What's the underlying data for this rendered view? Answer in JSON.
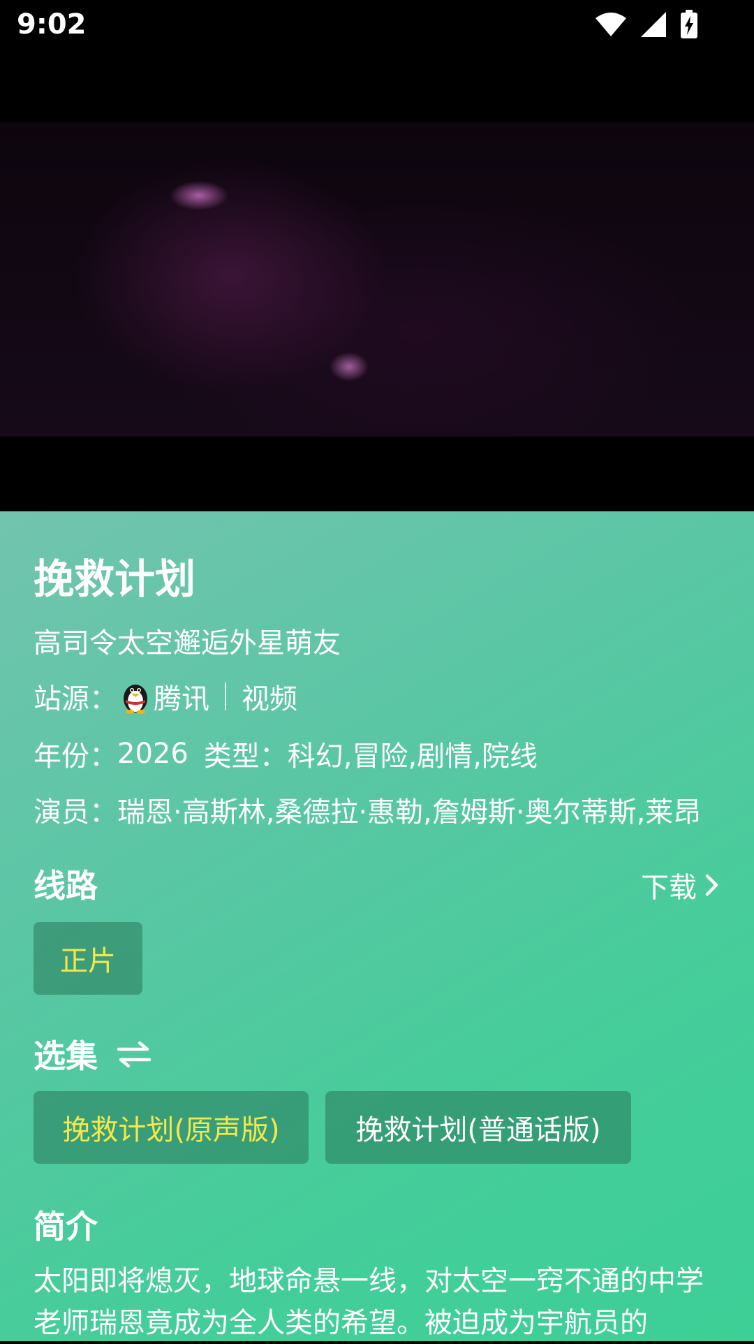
{
  "status_bar": {
    "time": "9:02",
    "icons": [
      "wifi-icon",
      "signal-icon",
      "battery-charging-icon"
    ]
  },
  "movie": {
    "title": "挽救计划",
    "subtitle": "高司令太空邂逅外星萌友",
    "source_label": "站源：",
    "source_name": "腾讯",
    "source_type": "视频",
    "year_label": "年份：",
    "year": "2026",
    "genre_label": "类型：",
    "genre": "科幻,冒险,剧情,院线",
    "actors_label": "演员：",
    "actors": "瑞恩·高斯林,桑德拉·惠勒,詹姆斯·奥尔蒂斯,莱昂"
  },
  "route": {
    "title": "线路",
    "download_label": "下载",
    "options": [
      {
        "label": "正片",
        "active": true
      }
    ]
  },
  "episodes": {
    "title": "选集",
    "items": [
      {
        "label": "挽救计划(原声版)",
        "active": true
      },
      {
        "label": "挽救计划(普通话版)",
        "active": false
      }
    ]
  },
  "intro": {
    "title": "简介",
    "text": "太阳即将熄灭，地球命悬一线，对太空一窍不通的中学老师瑞恩竟成为全人类的希望。被迫成为宇航员的"
  },
  "colors": {
    "active_chip_text": "#f5e84c",
    "panel_gradient_start": "#72c4ae",
    "panel_gradient_end": "#3dcf97"
  }
}
